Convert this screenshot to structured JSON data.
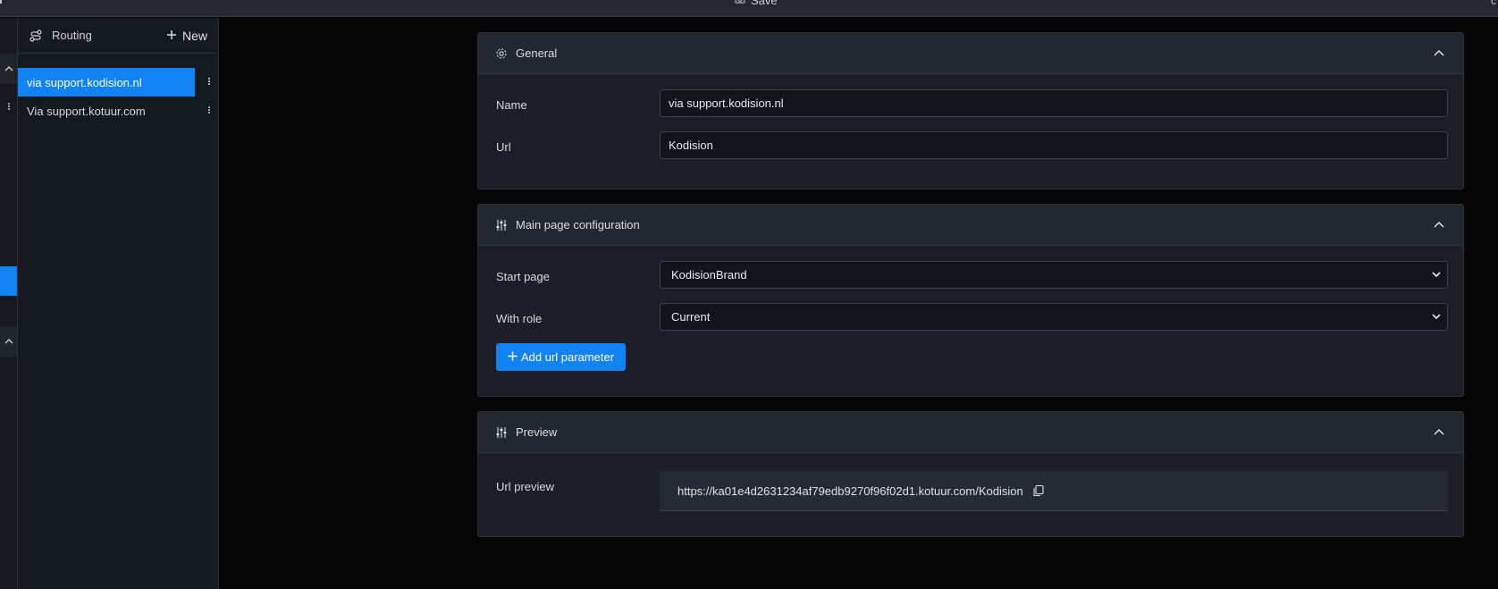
{
  "topbar": {
    "save_label": "Save"
  },
  "sidebar": {
    "title": "Routing",
    "new_label": "New",
    "items": [
      {
        "label": "via support.kodision.nl",
        "active": true
      },
      {
        "label": "Via support.kotuur.com",
        "active": false
      }
    ]
  },
  "general": {
    "title": "General",
    "name_label": "Name",
    "name_value": "via support.kodision.nl",
    "url_label": "Url",
    "url_value": "Kodision"
  },
  "main_page": {
    "title": "Main page configuration",
    "start_page_label": "Start page",
    "start_page_value": "KodisionBrand",
    "with_role_label": "With role",
    "with_role_value": "Current",
    "add_param_label": "Add url parameter"
  },
  "preview": {
    "title": "Preview",
    "url_preview_label": "Url preview",
    "url_preview_value": "https://ka01e4d2631234af79edb9270f96f02d1.kotuur.com/Kodision"
  },
  "colors": {
    "accent": "#1283f2",
    "panel": "#1b1e26",
    "background": "#060606"
  },
  "icons": [
    "camera-icon",
    "route-icon",
    "plus-icon",
    "kebab-icon",
    "gear-icon",
    "sliders-icon",
    "chevron-up-icon",
    "chevron-down-icon",
    "copy-icon"
  ]
}
